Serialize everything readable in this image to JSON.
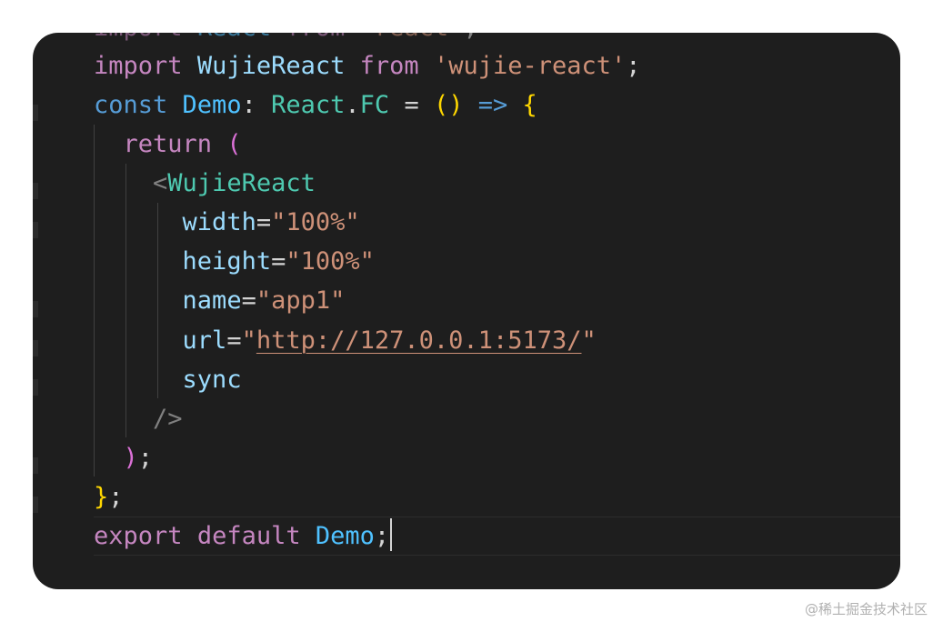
{
  "code": {
    "line_1": {
      "kw": "import",
      "ident": "React",
      "from": "from",
      "str": "'react'",
      "end": ";"
    },
    "line_2": {
      "kw": "import",
      "ident": "WujieReact",
      "from": "from",
      "str": "'wujie-react'",
      "end": ";"
    },
    "line_3": {
      "kw": "const",
      "name": "Demo",
      "colon": ":",
      "ns": "React",
      "dot": ".",
      "type": "FC",
      "eq": "=",
      "parens": "()",
      "arrow": "=>",
      "brace": "{"
    },
    "line_4": {
      "kw": "return",
      "paren": "("
    },
    "line_5": {
      "lt": "<",
      "tag": "WujieReact"
    },
    "line_6": {
      "attr": "width",
      "eq": "=",
      "value": "\"100%\""
    },
    "line_7": {
      "attr": "height",
      "eq": "=",
      "value": "\"100%\""
    },
    "line_8": {
      "attr": "name",
      "eq": "=",
      "value": "\"app1\""
    },
    "line_9": {
      "attr": "url",
      "eq": "=",
      "quote_open": "\"",
      "url": "http://127.0.0.1:5173/",
      "quote_close": "\""
    },
    "line_10": {
      "attr": "sync"
    },
    "line_11": {
      "close": "/>"
    },
    "line_12": {
      "paren": ")",
      "semi": ";"
    },
    "line_13": {
      "brace": "}",
      "semi": ";"
    },
    "line_14": {
      "kw1": "export",
      "kw2": "default",
      "name": "Demo",
      "semi": ";"
    }
  },
  "colors": {
    "background": "#1e1e1e",
    "keyword_control": "#c586c0",
    "keyword": "#569cd6",
    "identifier": "#9cdcfe",
    "type": "#4ec9b0",
    "string": "#ce9178",
    "bracket": "#ffd700"
  },
  "watermark": "@稀土掘金技术社区"
}
